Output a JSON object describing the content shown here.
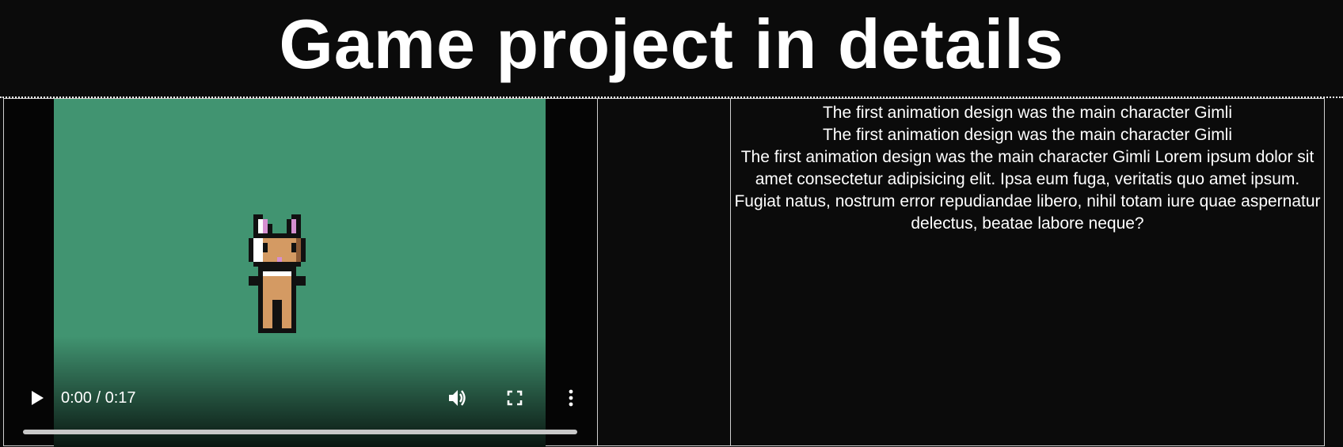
{
  "header": {
    "title": "Game project in details"
  },
  "video": {
    "current_time": "0:00",
    "separator": " / ",
    "duration": "0:17",
    "progress": 0,
    "background_color": "#419471",
    "icons": {
      "play": "play-icon",
      "volume": "volume-icon",
      "fullscreen": "fullscreen-icon",
      "more": "more-options-icon"
    }
  },
  "description": {
    "lines": [
      "The first animation design was the main character Gimli",
      "The first animation design was the main character Gimli",
      "The first animation design was the main character Gimli Lorem ipsum dolor sit amet consectetur adipisicing elit. Ipsa eum fuga, veritatis quo amet ipsum. Fugiat natus, nostrum error repudiandae libero, nihil totam iure quae aspernatur delectus, beatae labore neque?"
    ]
  }
}
